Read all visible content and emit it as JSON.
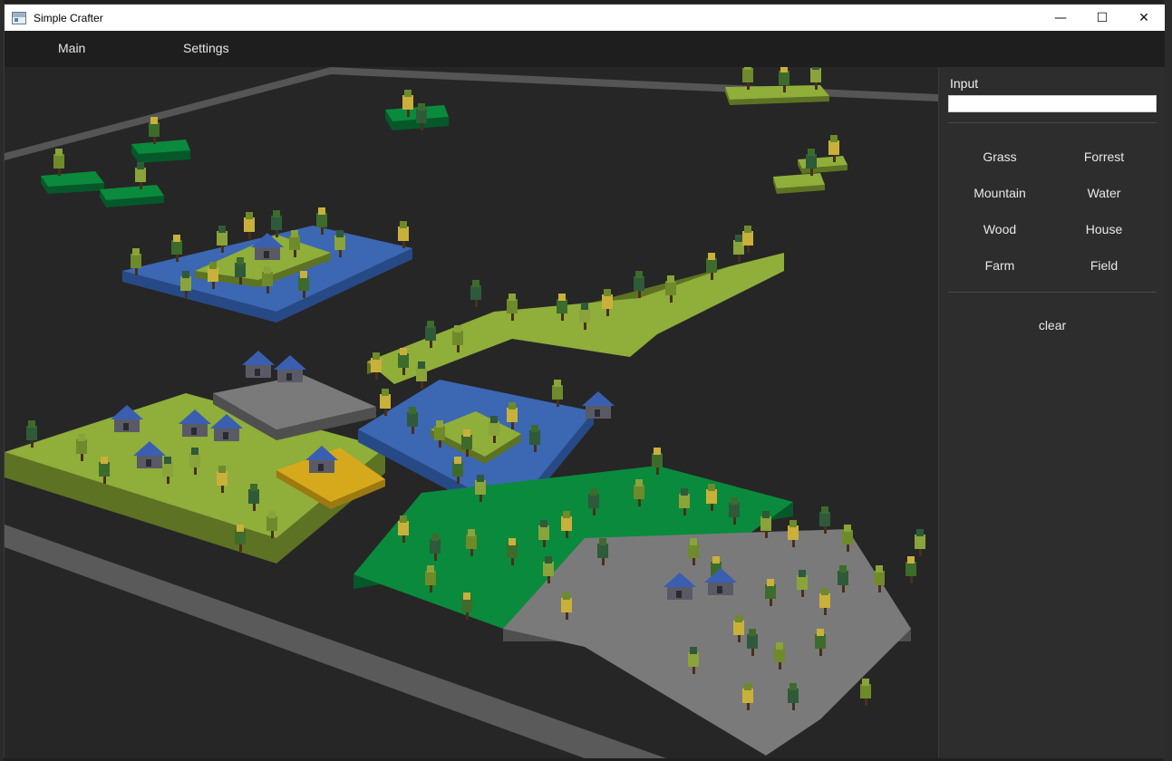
{
  "window": {
    "title": "Simple Crafter",
    "controls": {
      "minimize": "—",
      "maximize": "☐",
      "close": "✕"
    }
  },
  "menu": {
    "main": "Main",
    "settings": "Settings"
  },
  "panel": {
    "input_label": "Input",
    "input_value": "",
    "tiles": [
      {
        "label": "Grass"
      },
      {
        "label": "Forrest"
      },
      {
        "label": "Mountain"
      },
      {
        "label": "Water"
      },
      {
        "label": "Wood"
      },
      {
        "label": "House"
      },
      {
        "label": "Farm"
      },
      {
        "label": "Field"
      }
    ],
    "clear_label": "clear"
  },
  "colors": {
    "grass": "#8fae3a",
    "grass_side": "#5d7222",
    "forest": "#0a8a3c",
    "forest_side": "#06582a",
    "water": "#3b67b3",
    "water_side": "#274a86",
    "mountain": "#7a7a7a",
    "mountain_side": "#4f4f4f",
    "field": "#d6a81c",
    "field_side": "#9c7a10"
  }
}
